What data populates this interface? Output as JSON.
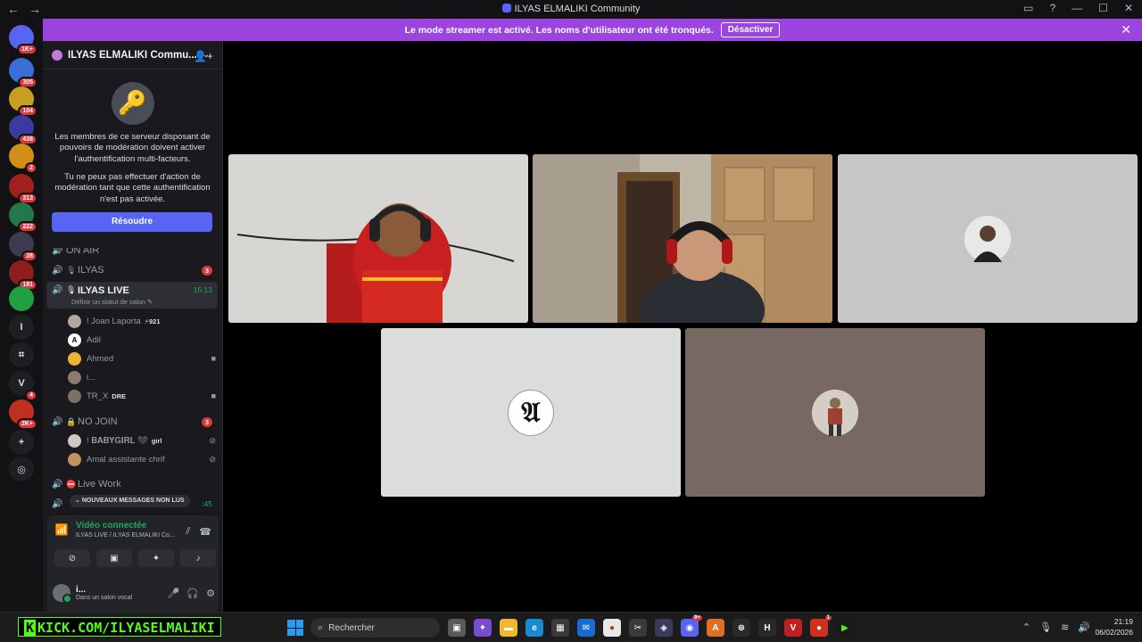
{
  "window": {
    "title": "ILYAS ELMALIKI Community",
    "nav_back": "←",
    "nav_forward": "→"
  },
  "banner": {
    "message": "Le mode streamer est activé. Les noms d'utilisateur ont été tronqués.",
    "button": "Désactiver",
    "close": "✕"
  },
  "servers": [
    {
      "name": "discord-home-icon",
      "badge": "1K+",
      "color": "#5865f2"
    },
    {
      "name": "server-1",
      "badge": "305",
      "color": "#3b6ed6"
    },
    {
      "name": "server-2",
      "badge": "104",
      "color": "#c8a020"
    },
    {
      "name": "server-3",
      "badge": "438",
      "color": "#3a3aa0"
    },
    {
      "name": "server-4",
      "badge": "2",
      "color": "#d09018"
    },
    {
      "name": "server-5",
      "badge": "313",
      "color": "#a0201e"
    },
    {
      "name": "server-6",
      "badge": "222",
      "color": "#22784a"
    },
    {
      "name": "server-7",
      "badge": "28",
      "color": "#3c3c50"
    },
    {
      "name": "server-8",
      "badge": "181",
      "color": "#8c1e1e"
    },
    {
      "name": "server-9",
      "badge": "",
      "color": "#20a040"
    },
    {
      "name": "server-i",
      "badge": "",
      "color": "#1e1f22",
      "letter": "I"
    },
    {
      "name": "server-hash",
      "badge": "",
      "color": "#1e1f22",
      "letter": "⌗"
    },
    {
      "name": "server-v",
      "badge": "4",
      "color": "#1e1f22",
      "letter": "V"
    },
    {
      "name": "server-10",
      "badge": "2K+",
      "color": "#c03020"
    },
    {
      "name": "add-server",
      "badge": "",
      "color": "#1e1f22",
      "letter": "+"
    },
    {
      "name": "discover",
      "badge": "",
      "color": "#1e1f22",
      "letter": "◎"
    }
  ],
  "server_header": {
    "name": "ILYAS ELMALIKI Commu...",
    "chevron": "⌄",
    "invite": "👤+"
  },
  "mfa": {
    "p1": "Les membres de ce serveur disposant de pouvoirs de modération doivent activer l'authentification multi-facteurs.",
    "p2": "Tu ne peux pas effectuer d'action de modération tant que cette authentification n'est pas activée.",
    "button": "Résoudre"
  },
  "channels": {
    "on_air": "ON AIR",
    "ilyas": {
      "label": "ILYAS",
      "count": "3"
    },
    "ilyas_live": {
      "label": "ILYAS LIVE",
      "time": "15:13",
      "sub": "Définir un statut de salon ✎"
    },
    "members_live": [
      {
        "name": "! Joan Laporta",
        "tag": "⚡921"
      },
      {
        "name": "Adil",
        "tag": ""
      },
      {
        "name": "Ahmed",
        "tag": ""
      },
      {
        "name": "i...",
        "tag": ""
      },
      {
        "name": "TR_X",
        "tag": "DRE"
      }
    ],
    "no_join": {
      "label": "NO JOIN",
      "count": "3"
    },
    "members_nojoin": [
      {
        "name": "! 𝐁𝐀𝐁𝐘𝐆𝐈𝐑𝐋 🖤",
        "tag": "girl"
      },
      {
        "name": "Amal assistante chrif",
        "tag": ""
      }
    ],
    "live_work": "Live Work",
    "last_time": ":45",
    "unread": "NOUVEAUX MESSAGES NON LUS"
  },
  "voice": {
    "title": "Vidéo connectée",
    "subtitle": "ILYAS LIVE / ILYAS ELMALIKI Co...",
    "user": "i...",
    "status": "Dans un salon vocal"
  },
  "video_tiles": [
    {
      "name": "video-tile-1",
      "bg": "#d8d6d2"
    },
    {
      "name": "video-tile-2",
      "bg": "#b8a890"
    },
    {
      "name": "video-tile-3",
      "bg": "#c6c6c6"
    },
    {
      "name": "video-tile-4",
      "bg": "#dcdcdc"
    },
    {
      "name": "video-tile-5",
      "bg": "#776961"
    }
  ],
  "taskbar": {
    "kick_text": "KICK.COM/ILYASELMALIKI",
    "kick_k": "K",
    "search": "Rechercher",
    "time": "21:19",
    "date": "06/02/2026"
  }
}
